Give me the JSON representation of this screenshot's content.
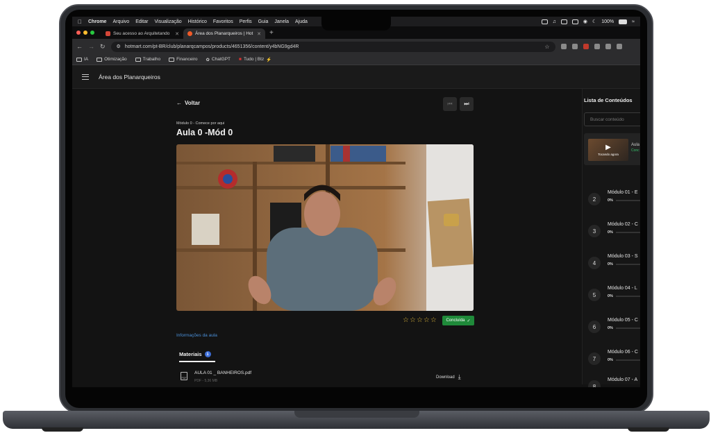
{
  "menubar": {
    "items": [
      "Chrome",
      "Arquivo",
      "Editar",
      "Visualização",
      "Histórico",
      "Favoritos",
      "Perfis",
      "Guia",
      "Janela",
      "Ajuda"
    ],
    "battery": "100%"
  },
  "tabs": [
    {
      "label": "Seu acesso ao Arquitetando",
      "favicon_color": "#d44638"
    },
    {
      "label": "Área dos Planarqueiros | Hot",
      "favicon_color": "#f05a28"
    }
  ],
  "toolbar": {
    "url": "hotmart.com/pt-BR/club/planarqcampos/products/4651356/content/y4bNG9gd4R"
  },
  "bookmarks": [
    {
      "label": "IA",
      "icon": "folder-icon"
    },
    {
      "label": "Otimização",
      "icon": "folder-icon"
    },
    {
      "label": "Trabalho",
      "icon": "folder-icon"
    },
    {
      "label": "Financeiro",
      "icon": "folder-icon"
    },
    {
      "label": "ChatGPT",
      "icon": "chatgpt-icon"
    },
    {
      "label": "Tudo | Btz",
      "icon": "page-icon"
    }
  ],
  "app": {
    "title": "Área dos Planarqueiros"
  },
  "lesson": {
    "back_label": "Voltar",
    "module_label": "Módulo 0 - Comece por aqui",
    "title": "Aula 0 -Mód 0",
    "rating_stars": 5,
    "rating_value": 0,
    "status_label": "Concluída",
    "info_link": "Informações da aula",
    "materials_tab": "Materiais",
    "materials_count": "1",
    "file": {
      "name": "AULA 01 _ BANHEIROS.pdf",
      "meta": "PDF - 5,36 MB",
      "type_label": "PDF",
      "download_label": "Download"
    }
  },
  "sidebar": {
    "title": "Lista de Conteúdos",
    "search_placeholder": "Buscar conteúdo",
    "now_playing": {
      "label": "Tocando agora",
      "title": "Aula",
      "sub": "Conc"
    },
    "modules": [
      {
        "num": "2",
        "title": "Módulo 01 - E",
        "pct": "0%"
      },
      {
        "num": "3",
        "title": "Módulo 02 - C",
        "pct": "0%"
      },
      {
        "num": "4",
        "title": "Módulo 03 - S",
        "pct": "0%"
      },
      {
        "num": "5",
        "title": "Módulo 04 - L",
        "pct": "0%"
      },
      {
        "num": "6",
        "title": "Módulo 05 - C",
        "pct": "0%"
      },
      {
        "num": "7",
        "title": "Módulo 06 - C",
        "pct": "0%"
      },
      {
        "num": "8",
        "title": "Módulo 07 - A",
        "pct": ""
      }
    ]
  }
}
